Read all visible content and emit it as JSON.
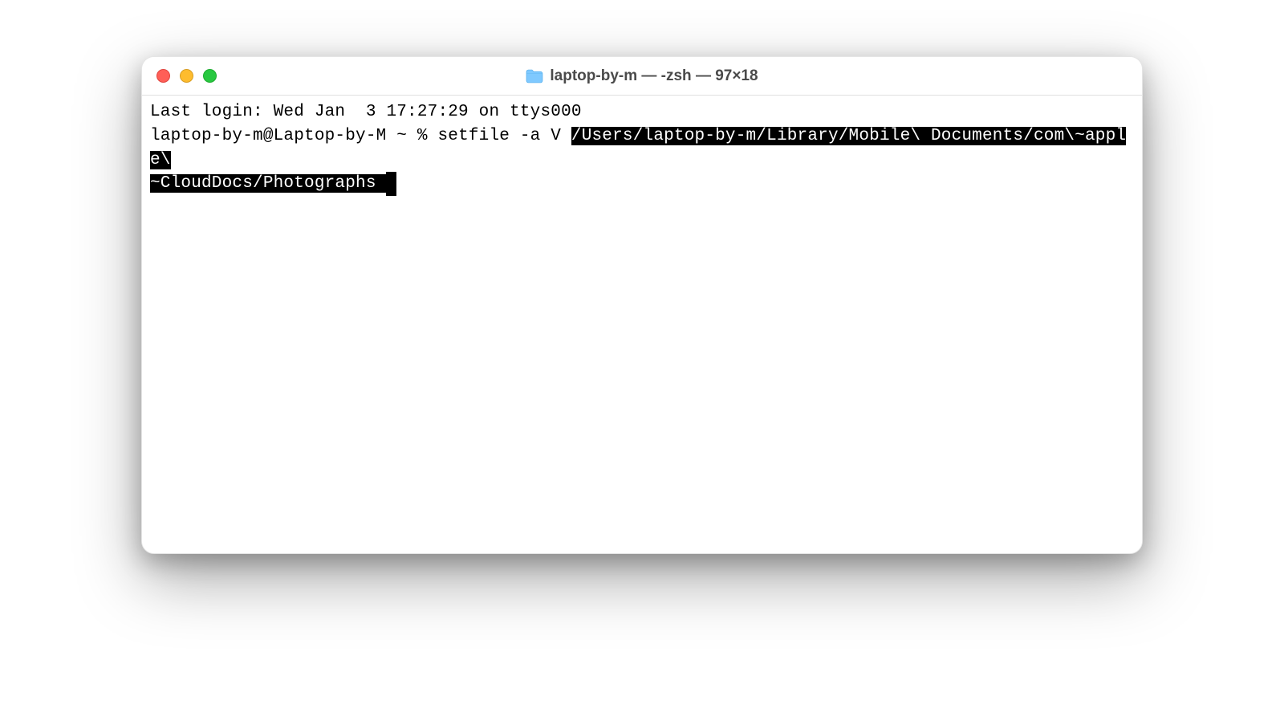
{
  "window": {
    "title": "laptop-by-m — -zsh — 97×18"
  },
  "terminal": {
    "last_login": "Last login: Wed Jan  3 17:27:29 on ttys000",
    "prompt": "laptop-by-m@Laptop-by-M ~ % ",
    "command": "setfile -a V ",
    "selected_path_line1": "/Users/laptop-by-m/Library/Mobile\\ Documents/com\\~apple\\",
    "selected_path_line2": "~CloudDocs/Photographs ",
    "cursor": " "
  }
}
